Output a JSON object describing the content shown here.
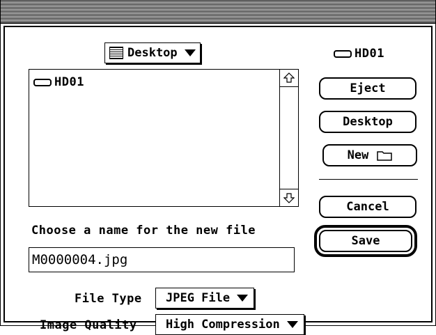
{
  "dialog": {
    "folder_popup": "Desktop",
    "volume_name": "HD01",
    "file_list": [
      {
        "name": "HD01",
        "icon": "hard-disk-icon"
      }
    ],
    "buttons": {
      "eject": "Eject",
      "desktop": "Desktop",
      "new": "New",
      "cancel": "Cancel",
      "save": "Save"
    },
    "name_prompt": "Choose a name for the new file",
    "file_name": "M0000004.jpg",
    "file_type_label": "File Type",
    "file_type_value": "JPEG File",
    "quality_label": "Image Quality",
    "quality_value": "High Compression"
  }
}
